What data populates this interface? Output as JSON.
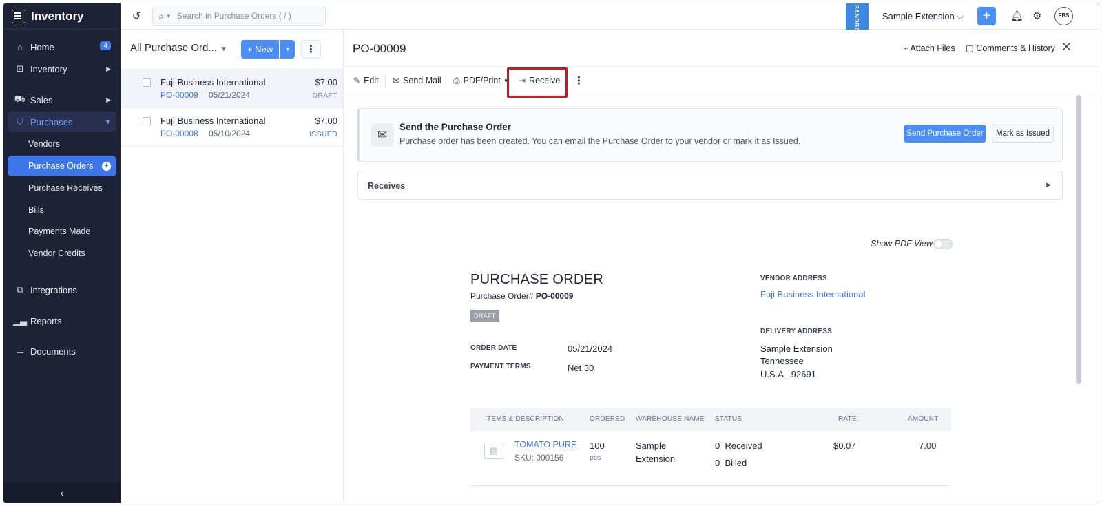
{
  "sidebar": {
    "brand": "Inventory",
    "items": [
      {
        "label": "Home",
        "icon": "home-icon",
        "badge": "4"
      },
      {
        "label": "Inventory",
        "icon": "inventory-icon"
      },
      {
        "label": "Sales",
        "icon": "cart-icon"
      },
      {
        "label": "Purchases",
        "icon": "bag-icon"
      }
    ],
    "purchases_sub": [
      "Vendors",
      "Purchase Orders",
      "Purchase Receives",
      "Bills",
      "Payments Made",
      "Vendor Credits"
    ],
    "bottom_items": [
      {
        "label": "Integrations",
        "icon": "integrations-icon"
      },
      {
        "label": "Reports",
        "icon": "reports-icon"
      },
      {
        "label": "Documents",
        "icon": "folder-icon"
      }
    ],
    "collapse": "‹"
  },
  "topbar": {
    "search_placeholder": "Search in Purchase Orders ( / )",
    "sandbox": "SANDBOX",
    "org": "Sample Extension ⌵",
    "avatar": "FBS",
    "plus": "+"
  },
  "list": {
    "view_title": "All Purchase Ord...",
    "new_label": "+ New",
    "rows": [
      {
        "vendor": "Fuji Business International",
        "po": "PO-00009",
        "date": "05/21/2024",
        "amount": "$7.00",
        "status": "DRAFT",
        "status_color": "#8a8fa3"
      },
      {
        "vendor": "Fuji Business International",
        "po": "PO-00008",
        "date": "05/10/2024",
        "amount": "$7.00",
        "status": "ISSUED",
        "status_color": "#3c76e8"
      }
    ]
  },
  "detail": {
    "title": "PO-00009",
    "attach": "Attach Files",
    "comments": "Comments & History",
    "toolbar": {
      "edit": "Edit",
      "send_mail": "Send Mail",
      "pdf_print": "PDF/Print",
      "receive": "Receive"
    },
    "banner": {
      "title": "Send the Purchase Order",
      "text": "Purchase order has been created. You can email the Purchase Order to your vendor or mark it as Issued.",
      "send_btn": "Send Purchase Order",
      "issued_btn": "Mark as Issued"
    },
    "receives_label": "Receives",
    "pdf_view_label": "Show PDF View",
    "pdf_view_on": false,
    "doc": {
      "heading": "PURCHASE ORDER",
      "number_label": "Purchase Order#",
      "number": "PO-00009",
      "badge": "DRAFT",
      "order_date_label": "ORDER DATE",
      "order_date": "05/21/2024",
      "payment_terms_label": "PAYMENT TERMS",
      "payment_terms": "Net 30",
      "vendor_address_label": "VENDOR ADDRESS",
      "vendor_name": "Fuji Business International",
      "delivery_address_label": "DELIVERY ADDRESS",
      "delivery_lines": [
        "Sample Extension",
        "Tennessee",
        "U.S.A - 92691"
      ]
    },
    "items": {
      "headers": [
        "ITEMS & DESCRIPTION",
        "ORDERED",
        "WAREHOUSE NAME",
        "STATUS",
        "RATE",
        "AMOUNT"
      ],
      "rows": [
        {
          "name": "TOMATO PURE",
          "sku": "SKU: 000156",
          "ordered": "100",
          "unit": "pcs",
          "warehouse_1": "Sample",
          "warehouse_2": "Extension",
          "received": "0  Received",
          "billed": "0  Billed",
          "rate": "$0.07",
          "amount": "7.00"
        }
      ]
    }
  },
  "colors": {
    "sidebar_bg": "#1f2337",
    "accent": "#4b8ef5",
    "highlight_box": "#d0181c"
  }
}
